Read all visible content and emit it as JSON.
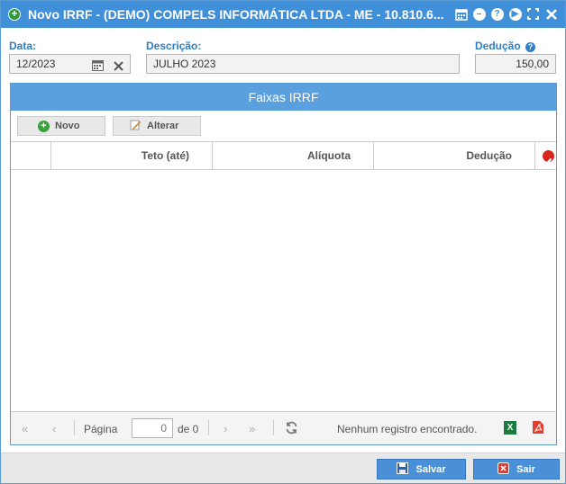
{
  "window": {
    "title": "Novo IRRF - (DEMO) COMPELS INFORMÁTICA LTDA - ME - 10.810.6..."
  },
  "form": {
    "data_label": "Data:",
    "data_value": "12/2023",
    "descricao_label": "Descrição:",
    "descricao_value": "JULHO 2023",
    "deducao_label": "Dedução",
    "deducao_value": "150,00"
  },
  "panel": {
    "title": "Faixas IRRF",
    "buttons": {
      "novo": "Novo",
      "alterar": "Alterar"
    },
    "columns": [
      "Teto (até)",
      "Alíquota",
      "Dedução"
    ],
    "rows": []
  },
  "pager": {
    "page_label": "Página",
    "page_value": "0",
    "of_label": "de 0",
    "status": "Nenhum registro encontrado."
  },
  "footer": {
    "save_label": "Salvar",
    "exit_label": "Sair"
  },
  "colors": {
    "titlebar": "#3f8fd9",
    "label": "#2c7fc9",
    "panel_header": "#5aa0df",
    "button": "#4a90d9"
  }
}
